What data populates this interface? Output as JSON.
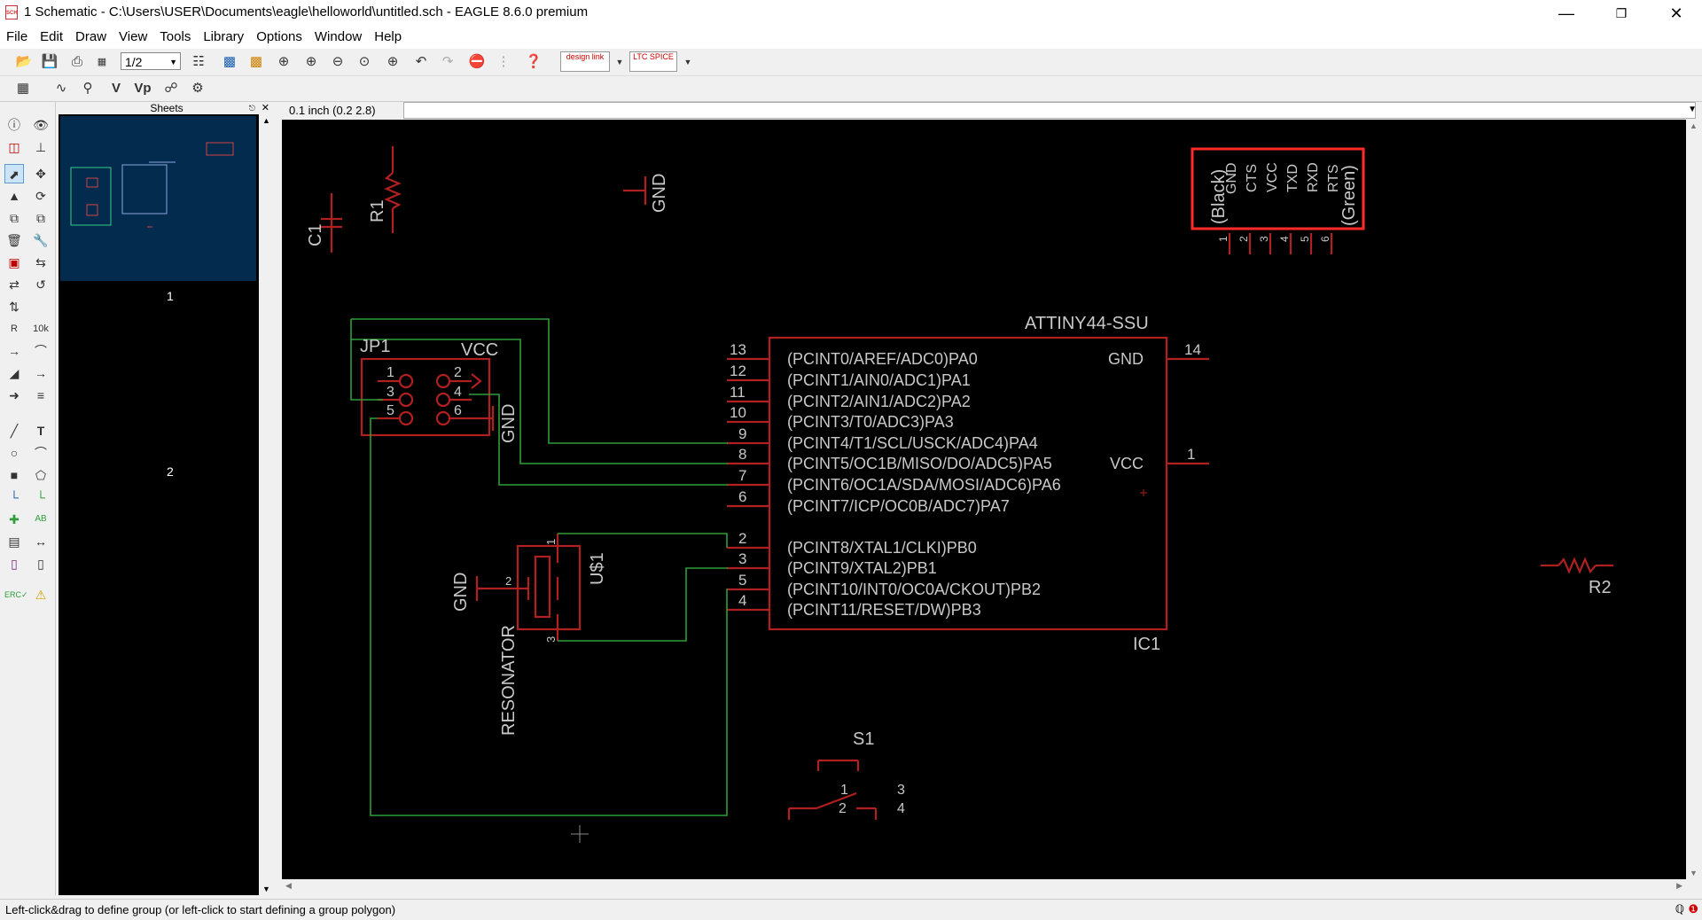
{
  "window": {
    "title": "1 Schematic - C:\\Users\\USER\\Documents\\eagle\\helloworld\\untitled.sch - EAGLE 8.6.0 premium",
    "app_icon": "SCH"
  },
  "menu": [
    "File",
    "Edit",
    "Draw",
    "View",
    "Tools",
    "Library",
    "Options",
    "Window",
    "Help"
  ],
  "toolbar": {
    "sheet_select": "1/2",
    "design_link_label": "design link",
    "ltspice_label": "LTC SPICE"
  },
  "sheets_panel": {
    "title": "Sheets",
    "sheets": [
      "1",
      "2"
    ]
  },
  "command": {
    "coordinates": "0.1 inch (0.2 2.8)",
    "value": ""
  },
  "schematic": {
    "parts": {
      "c1": "C1",
      "r1": "R1",
      "r2": "R2",
      "gnd_top": "GND",
      "jp1": "JP1",
      "jp1_vcc": "VCC",
      "jp1_gnd": "GND",
      "jp1_pins": [
        "1",
        "2",
        "3",
        "4",
        "5",
        "6"
      ],
      "ftdi_labels": [
        "(Black)",
        "GND",
        "CTS",
        "VCC",
        "TXD",
        "RXD",
        "RTS",
        "(Green)"
      ],
      "ftdi_pins": [
        "1",
        "2",
        "3",
        "4",
        "5",
        "6"
      ],
      "ic_name": "ATTINY44-SSU",
      "ic_ref": "IC1",
      "ic_left_pins": [
        {
          "num": "13",
          "label": "(PCINT0/AREF/ADC0)PA0"
        },
        {
          "num": "12",
          "label": "(PCINT1/AIN0/ADC1)PA1"
        },
        {
          "num": "11",
          "label": "(PCINT2/AIN1/ADC2)PA2"
        },
        {
          "num": "10",
          "label": "(PCINT3/T0/ADC3)PA3"
        },
        {
          "num": "9",
          "label": "(PCINT4/T1/SCL/USCK/ADC4)PA4"
        },
        {
          "num": "8",
          "label": "(PCINT5/OC1B/MISO/DO/ADC5)PA5"
        },
        {
          "num": "7",
          "label": "(PCINT6/OC1A/SDA/MOSI/ADC6)PA6"
        },
        {
          "num": "6",
          "label": "(PCINT7/ICP/OC0B/ADC7)PA7"
        },
        {
          "num": "2",
          "label": "(PCINT8/XTAL1/CLKI)PB0"
        },
        {
          "num": "3",
          "label": "(PCINT9/XTAL2)PB1"
        },
        {
          "num": "5",
          "label": "(PCINT10/INT0/OC0A/CKOUT)PB2"
        },
        {
          "num": "4",
          "label": "(PCINT11/RESET/DW)PB3"
        }
      ],
      "ic_gnd": "GND",
      "ic_gnd_pin": "14",
      "ic_vcc": "VCC",
      "ic_vcc_pin": "1",
      "resonator_ref": "U$1",
      "resonator_value": "RESONATOR",
      "resonator_gnd": "GND",
      "resonator_pins": [
        "1",
        "2",
        "3"
      ],
      "s1": "S1",
      "s1_pins": [
        "1",
        "2",
        "3",
        "4"
      ]
    }
  },
  "status_bar": "Left-click&drag to define group (or left-click to start defining a group polygon)",
  "colors": {
    "canvas": "#000000",
    "part": "#b02020",
    "wire": "#2e9e3a",
    "text": "#c8c8c8",
    "frame": "#ff2a2a"
  }
}
